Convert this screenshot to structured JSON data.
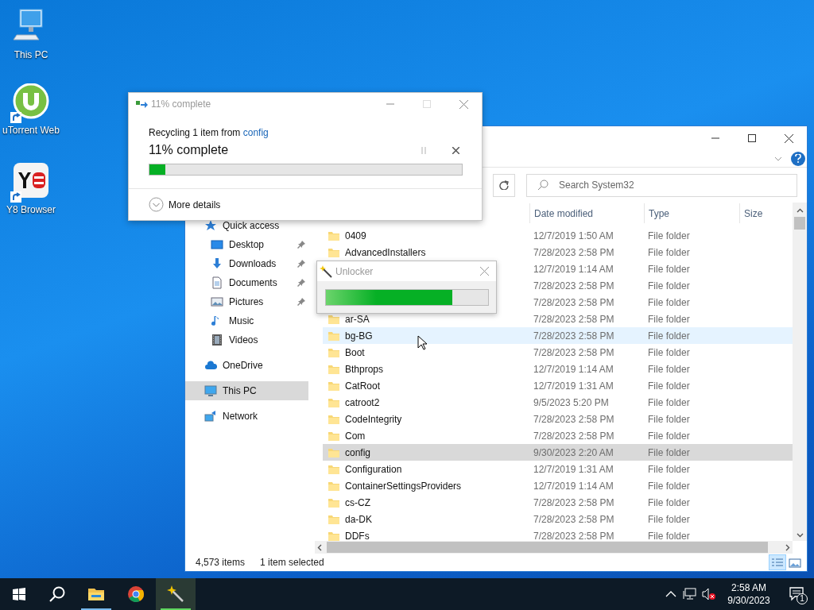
{
  "desktop_icons": [
    {
      "label": "This PC",
      "kind": "pc",
      "shortcut": false
    },
    {
      "label": "uTorrent Web",
      "kind": "utorrent",
      "shortcut": true
    },
    {
      "label": "Y8 Browser",
      "kind": "y8",
      "shortcut": true
    }
  ],
  "explorer": {
    "search_placeholder": "Search System32",
    "columns": [
      "Date modified",
      "Type",
      "Size"
    ],
    "nav": [
      {
        "label": "Quick access",
        "kind": "star",
        "selected": false,
        "children": [
          {
            "label": "Desktop",
            "kind": "desktop",
            "pinned": true,
            "selected": false
          },
          {
            "label": "Downloads",
            "kind": "downloads",
            "pinned": true,
            "selected": false
          },
          {
            "label": "Documents",
            "kind": "documents",
            "pinned": true,
            "selected": false
          },
          {
            "label": "Pictures",
            "kind": "pictures",
            "pinned": true,
            "selected": false
          },
          {
            "label": "Music",
            "kind": "music",
            "pinned": false,
            "selected": false
          },
          {
            "label": "Videos",
            "kind": "videos",
            "pinned": false,
            "selected": false
          }
        ]
      },
      {
        "label": "OneDrive",
        "kind": "cloud",
        "selected": false
      },
      {
        "label": "This PC",
        "kind": "pc",
        "selected": true
      },
      {
        "label": "Network",
        "kind": "network",
        "selected": false
      }
    ],
    "rows": [
      {
        "name": "0409",
        "date": "12/7/2019 1:50 AM",
        "type": "File folder",
        "selected": false,
        "hovered": false
      },
      {
        "name": "AdvancedInstallers",
        "date": "7/28/2023 2:58 PM",
        "type": "File folder",
        "selected": false,
        "hovered": false
      },
      {
        "date": "12/7/2019 1:14 AM",
        "type": "File folder",
        "selected": false,
        "hovered": false
      },
      {
        "date": "7/28/2023 2:58 PM",
        "type": "File folder",
        "selected": false,
        "hovered": false
      },
      {
        "date": "7/28/2023 2:58 PM",
        "type": "File folder",
        "selected": false,
        "hovered": false
      },
      {
        "name": "ar-SA",
        "date": "7/28/2023 2:58 PM",
        "type": "File folder",
        "selected": false,
        "hovered": false
      },
      {
        "name": "bg-BG",
        "date": "7/28/2023 2:58 PM",
        "type": "File folder",
        "selected": false,
        "hovered": true
      },
      {
        "name": "Boot",
        "date": "7/28/2023 2:58 PM",
        "type": "File folder",
        "selected": false,
        "hovered": false
      },
      {
        "name": "Bthprops",
        "date": "12/7/2019 1:14 AM",
        "type": "File folder",
        "selected": false,
        "hovered": false
      },
      {
        "name": "CatRoot",
        "date": "12/7/2019 1:31 AM",
        "type": "File folder",
        "selected": false,
        "hovered": false
      },
      {
        "name": "catroot2",
        "date": "9/5/2023 5:20 PM",
        "type": "File folder",
        "selected": false,
        "hovered": false
      },
      {
        "name": "CodeIntegrity",
        "date": "7/28/2023 2:58 PM",
        "type": "File folder",
        "selected": false,
        "hovered": false
      },
      {
        "name": "Com",
        "date": "7/28/2023 2:58 PM",
        "type": "File folder",
        "selected": false,
        "hovered": false
      },
      {
        "name": "config",
        "date": "9/30/2023 2:20 AM",
        "type": "File folder",
        "selected": true,
        "hovered": false
      },
      {
        "name": "Configuration",
        "date": "12/7/2019 1:31 AM",
        "type": "File folder",
        "selected": false,
        "hovered": false
      },
      {
        "name": "ContainerSettingsProviders",
        "date": "12/7/2019 1:14 AM",
        "type": "File folder",
        "selected": false,
        "hovered": false
      },
      {
        "name": "cs-CZ",
        "date": "7/28/2023 2:58 PM",
        "type": "File folder",
        "selected": false,
        "hovered": false
      },
      {
        "name": "da-DK",
        "date": "7/28/2023 2:58 PM",
        "type": "File folder",
        "selected": false,
        "hovered": false
      },
      {
        "name": "DDFs",
        "date": "7/28/2023 2:58 PM",
        "type": "File folder",
        "selected": false,
        "hovered": false
      }
    ],
    "status_count": "4,573 items",
    "status_selection": "1 item selected",
    "views": [
      {
        "kind": "details",
        "selected": true
      },
      {
        "kind": "thumbnails",
        "selected": false
      }
    ]
  },
  "progress_dialog": {
    "title": "11% complete",
    "message": "Recycling 1 item from",
    "source_link": "config",
    "heading": "11% complete",
    "level": 0.05,
    "details": "More details"
  },
  "unlocker": {
    "title": "Unlocker",
    "level": 0.78
  },
  "taskbar": {
    "apps": [
      {
        "kind": "explorer",
        "active": true,
        "selected": false
      },
      {
        "kind": "chrome",
        "active": false,
        "selected": false
      },
      {
        "kind": "unlocker",
        "active": true,
        "selected": true
      }
    ],
    "time": "2:58 AM",
    "date": "9/30/2023",
    "notifications": "1"
  }
}
